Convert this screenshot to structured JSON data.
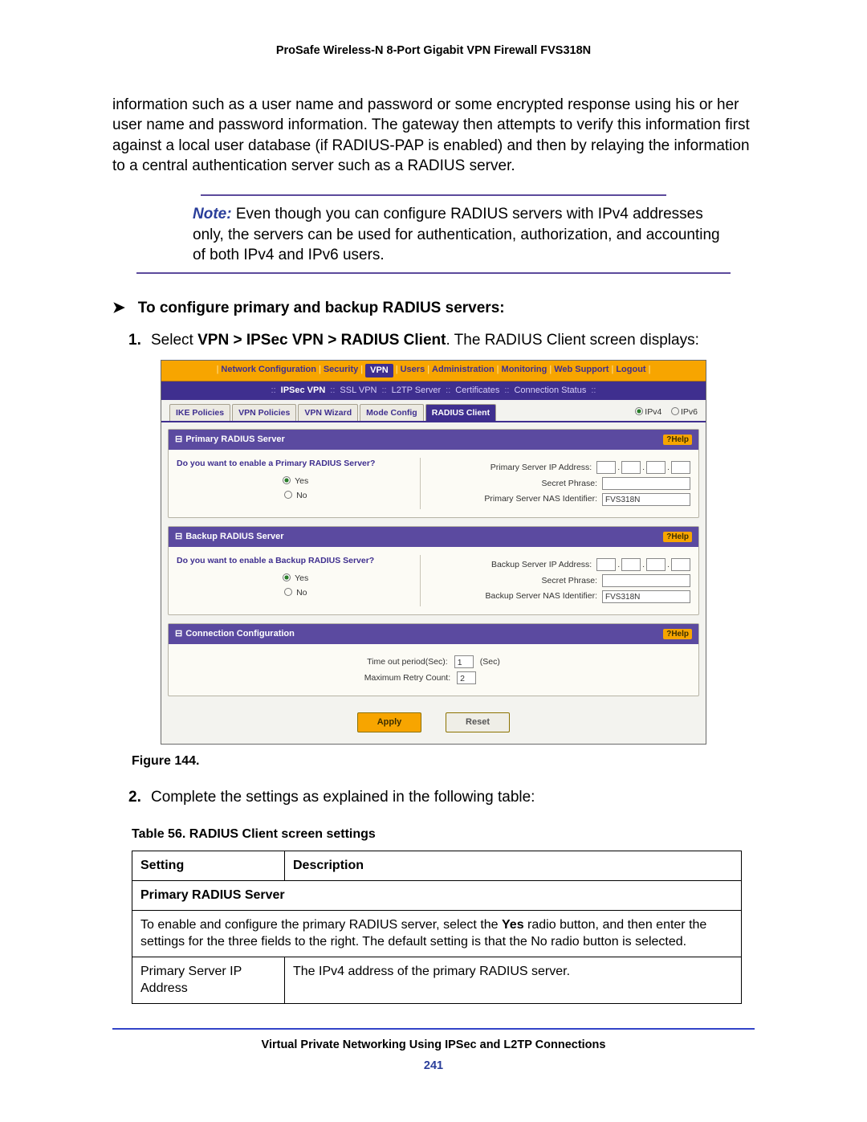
{
  "doc_title": "ProSafe Wireless-N 8-Port Gigabit VPN Firewall FVS318N",
  "intro": "information such as a user name and password or some encrypted response using his or her user name and password information. The gateway then attempts to verify this information first against a local user database (if RADIUS-PAP is enabled) and then by relaying the information to a central authentication server such as a RADIUS server.",
  "note": {
    "label": "Note:",
    "text": "Even though you can configure RADIUS servers with IPv4 addresses only, the servers can be used for authentication, authorization, and accounting of both IPv4 and IPv6 users."
  },
  "procedure": {
    "arrow": "➤",
    "heading": "To configure primary and backup RADIUS servers:",
    "step1_prefix": "Select ",
    "step1_bold": "VPN > IPSec VPN > RADIUS Client",
    "step1_suffix": ". The RADIUS Client screen displays:",
    "step2": "Complete the settings as explained in the following table:"
  },
  "screenshot": {
    "nav1": [
      "Network Configuration",
      "Security",
      "VPN",
      "Users",
      "Administration",
      "Monitoring",
      "Web Support",
      "Logout"
    ],
    "nav1_selected": "VPN",
    "nav2": [
      "IPSec VPN",
      "SSL VPN",
      "L2TP Server",
      "Certificates",
      "Connection Status"
    ],
    "nav2_selected": "IPSec VPN",
    "tabs": [
      "IKE Policies",
      "VPN Policies",
      "VPN Wizard",
      "Mode Config",
      "RADIUS Client"
    ],
    "tab_selected": "RADIUS Client",
    "ipver": {
      "ipv4": "IPv4",
      "ipv6": "IPv6"
    },
    "help": "Help",
    "help_icon": "?",
    "panel1": {
      "title": "Primary RADIUS Server",
      "question": "Do you want to enable a Primary RADIUS Server?",
      "yes": "Yes",
      "no": "No",
      "fields": {
        "ip": "Primary Server IP Address:",
        "secret": "Secret Phrase:",
        "nas": "Primary Server NAS Identifier:",
        "nas_value": "FVS318N"
      }
    },
    "panel2": {
      "title": "Backup RADIUS Server",
      "question": "Do you want to enable a Backup RADIUS Server?",
      "yes": "Yes",
      "no": "No",
      "fields": {
        "ip": "Backup Server IP Address:",
        "secret": "Secret Phrase:",
        "nas": "Backup Server NAS Identifier:",
        "nas_value": "FVS318N"
      }
    },
    "panel3": {
      "title": "Connection Configuration",
      "timeout_label": "Time out period(Sec):",
      "timeout_value": "1",
      "timeout_unit": "(Sec)",
      "retry_label": "Maximum Retry Count:",
      "retry_value": "2"
    },
    "buttons": {
      "apply": "Apply",
      "reset": "Reset"
    }
  },
  "figure_caption": "Figure 144.",
  "table_caption": "Table 56.  RADIUS Client screen settings",
  "table": {
    "header": {
      "setting": "Setting",
      "description": "Description"
    },
    "section": "Primary RADIUS Server",
    "section_text_a": "To enable and configure the primary RADIUS server, select the ",
    "section_text_bold": "Yes",
    "section_text_b": " radio button, and then enter the settings for the three fields to the right. The default setting is that the No radio button is selected.",
    "row1": {
      "setting": "Primary Server IP Address",
      "desc": "The IPv4 address of the primary RADIUS server."
    }
  },
  "footer": "Virtual Private Networking Using IPSec and L2TP Connections",
  "page_number": "241"
}
